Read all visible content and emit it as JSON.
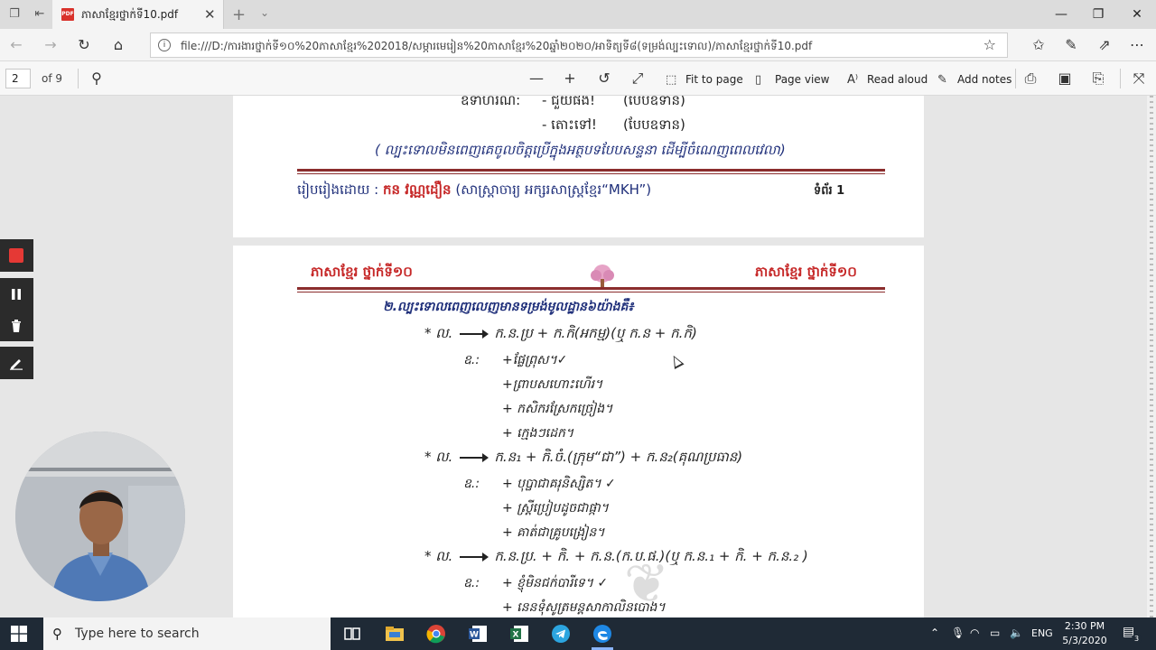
{
  "browser": {
    "tab_title": "ភាសាខ្មែរថ្នាក់ទី10.pdf",
    "pdf_icon_text": "PDF",
    "url": "file:///D:/ការងារថ្នាក់ទី១០%20ភាសាខ្មែរ%202018/សម្ភារមេរៀន%20ភាសាខ្មែរ%20ឆ្នាំ២០២០/អាទិត្យទី៨(ទម្រង់ល្បះទោល)/ភាសាខ្មែរថ្នាក់ទី10.pdf"
  },
  "pdf_toolbar": {
    "page_number": "2",
    "page_of": "of 9",
    "fit_to_page": "Fit to page",
    "page_view": "Page view",
    "read_aloud": "Read aloud",
    "add_notes": "Add notes"
  },
  "page1": {
    "example_label": "ឧទាហរណ៍:",
    "example1": "- ជួយផង!",
    "example1_form": "(បែបឧទាន)",
    "example2": "- តោះទៅ!",
    "example2_form": "(បែបឧទាន)",
    "note": "( ល្បះទោលមិនពេញគេចូលចិត្តប្រើក្នុងអត្ថបទបែបសន្ទនា ដើម្បីចំណេញពេលវេលា)",
    "footer_prefix": "រៀបរៀងដោយ :",
    "author": "កន វណ្ណដឿន",
    "footer_suffix": "(សាស្ត្រាចារ្យ អក្សរសាស្ត្រខ្មែរ“MKH”)",
    "page_label": "ទំព័រ 1"
  },
  "page2": {
    "header_left": "ភាសាខ្មែរ ថ្នាក់ទី១០",
    "header_right": "ភាសាខ្មែរ ថ្នាក់ទី១០",
    "section_title": "២.ល្បះទោលពេញលេញមានទម្រង់មូលដ្ឋាន៦យ៉ាងគឺ៖",
    "rule1": "ក.ន.ប្រ + ក.កិ(អកម្ម)(ឬ ក.ន + ក.កិ)",
    "rule1_examples": [
      "+ផ្លែព្រុស។✓",
      "+ព្រាបសហោះហើរ។",
      "+ កសិករស្រែកច្រៀង។",
      "+ ក្មេងៗដេក។"
    ],
    "rule2": "ក.ន₁ + កិ.ចំ.(ក្រុម“ជា”) + ក.ន₂(គុណប្រធាន)",
    "rule2_examples": [
      "+ បុប្ផាជាគរុនិស្សិត។ ✓",
      "+ ស្ត្រីប្រៀបដូចជាផ្កា។",
      "+ គាត់ជាគ្រូបង្រៀន។"
    ],
    "rule3": "ក.ន.ប្រ. + កិ. + ក.ន.(ក.ប.ផ.)(ឬ ក.ន.₁ + កិ. + ក.ន.₂ )",
    "rule3_examples": [
      "+ ខ្ញុំមិនជក់បារីទេ។ ✓",
      "+ នេនទុំសូត្រមន្តសាកាលិនបោង។"
    ],
    "bullet": "* ល.",
    "ex_label": "ឧ.:"
  },
  "taskbar": {
    "search_placeholder": "Type here to search",
    "lang": "ENG",
    "time": "2:30 PM",
    "date": "5/3/2020",
    "notif_count": "3"
  },
  "colors": {
    "accent_red": "#c62828",
    "navy_text": "#1f2f7a",
    "rule_red": "#8b2d2d",
    "taskbar": "#1f2a36"
  }
}
